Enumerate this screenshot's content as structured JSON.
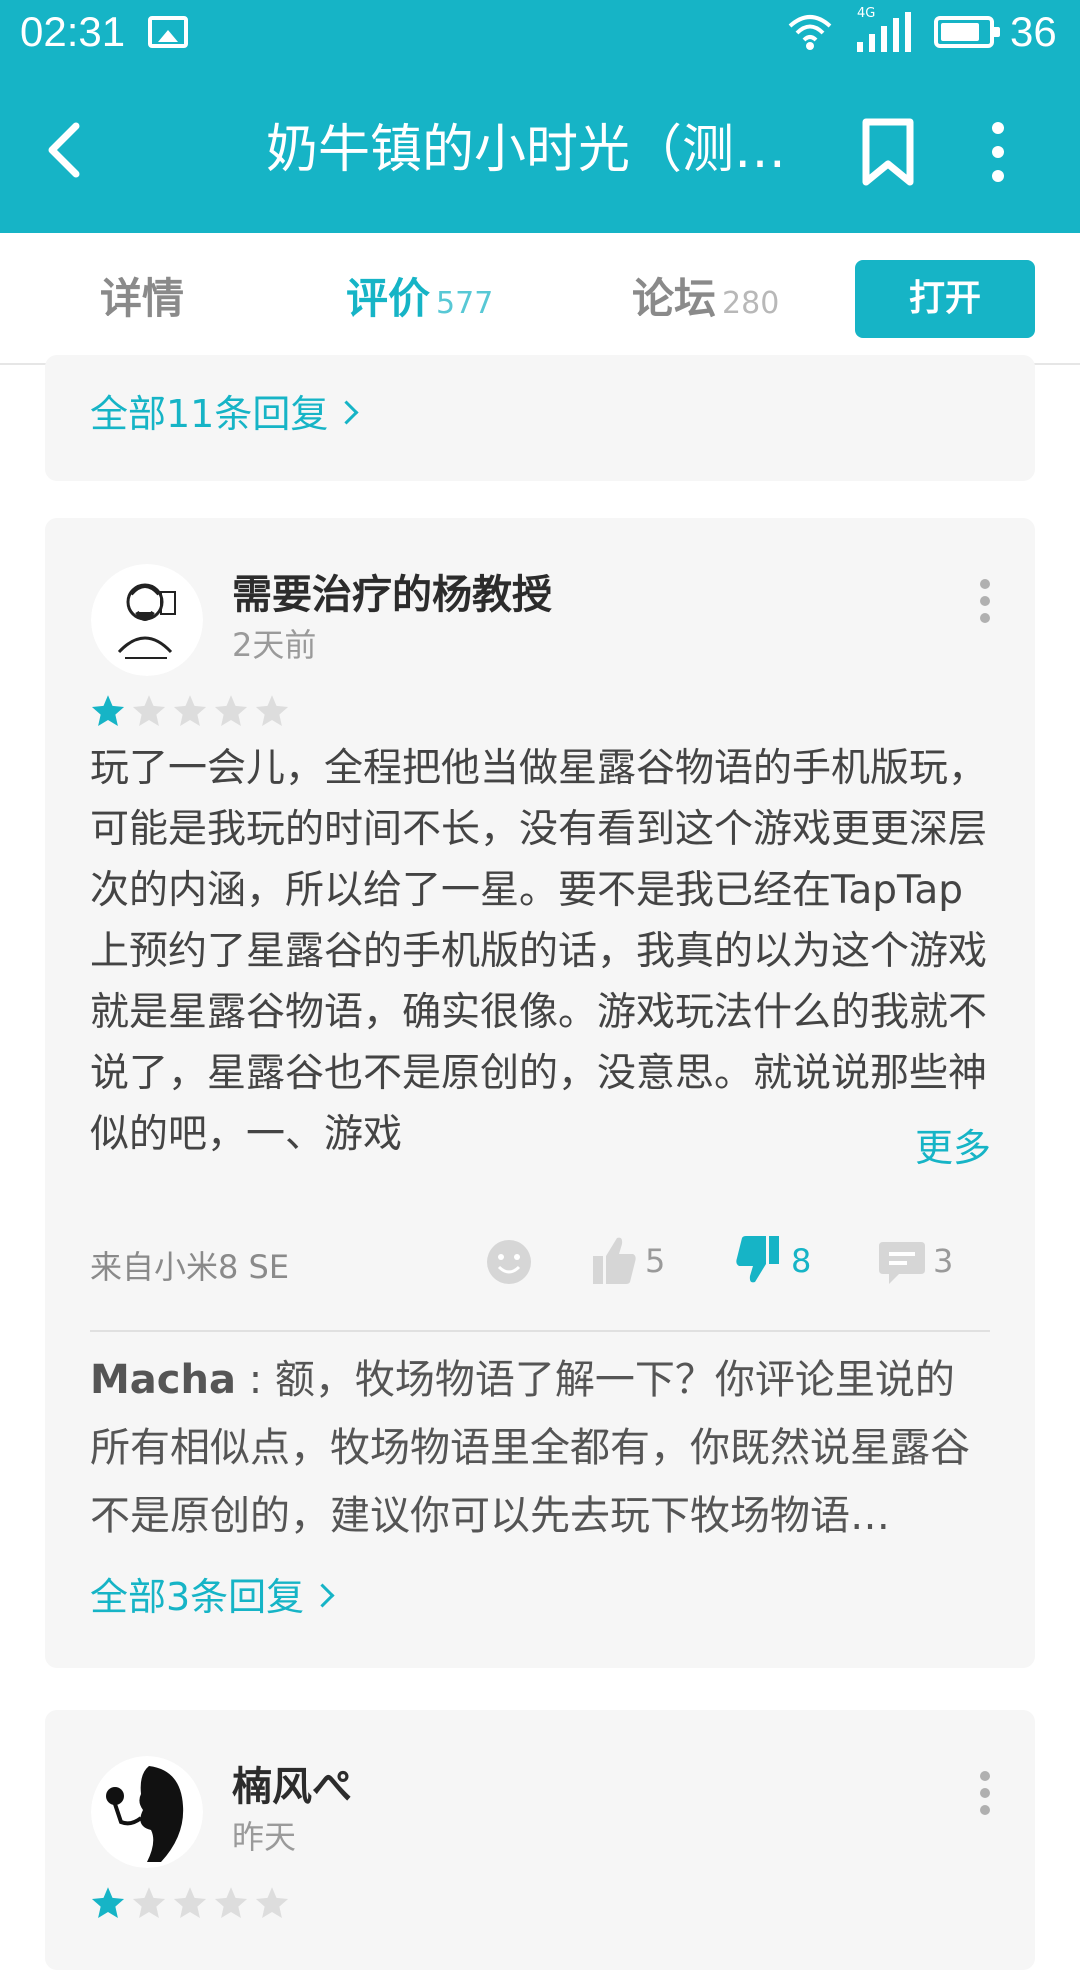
{
  "status_bar": {
    "time": "02:31",
    "network": "4G",
    "battery": "36"
  },
  "toolbar": {
    "title": "奶牛镇的小时光（测…"
  },
  "tabs": [
    {
      "label": "详情",
      "count": ""
    },
    {
      "label": "评价",
      "count": "577"
    },
    {
      "label": "论坛",
      "count": "280"
    }
  ],
  "open_button": "打开",
  "prev_card": {
    "replies_link": "全部11条回复"
  },
  "review_1": {
    "username": "需要治疗的杨教授",
    "time": "2天前",
    "rating": 1,
    "max_rating": 5,
    "text": "玩了一会儿，全程把他当做星露谷物语的手机版玩，可能是我玩的时间不长，没有看到这个游戏更更深层次的内涵，所以给了一星。要不是我已经在TapTap上预约了星露谷的手机版的话，我真的以为这个游戏就是星露谷物语，确实很像。游戏玩法什么的我就不说了，星露谷也不是原创的，没意思。就说说那些神似的吧，一、游戏",
    "more_label": "更多",
    "device": "来自小米8 SE",
    "likes": "5",
    "dislikes": "8",
    "comments": "3",
    "reply": {
      "author": "Macha",
      "text": "额，牧场物语了解一下？你评论里说的所有相似点，牧场物语里全都有，你既然说星露谷不是原创的，建议你可以先去玩下牧场物语…"
    },
    "replies_link": "全部3条回复"
  },
  "review_2": {
    "username": "楠风ぺ",
    "time": "昨天",
    "rating": 1,
    "max_rating": 5
  },
  "colors": {
    "accent": "#16b4c6",
    "card_bg": "#f6f6f6",
    "star_off": "#dddddd"
  }
}
